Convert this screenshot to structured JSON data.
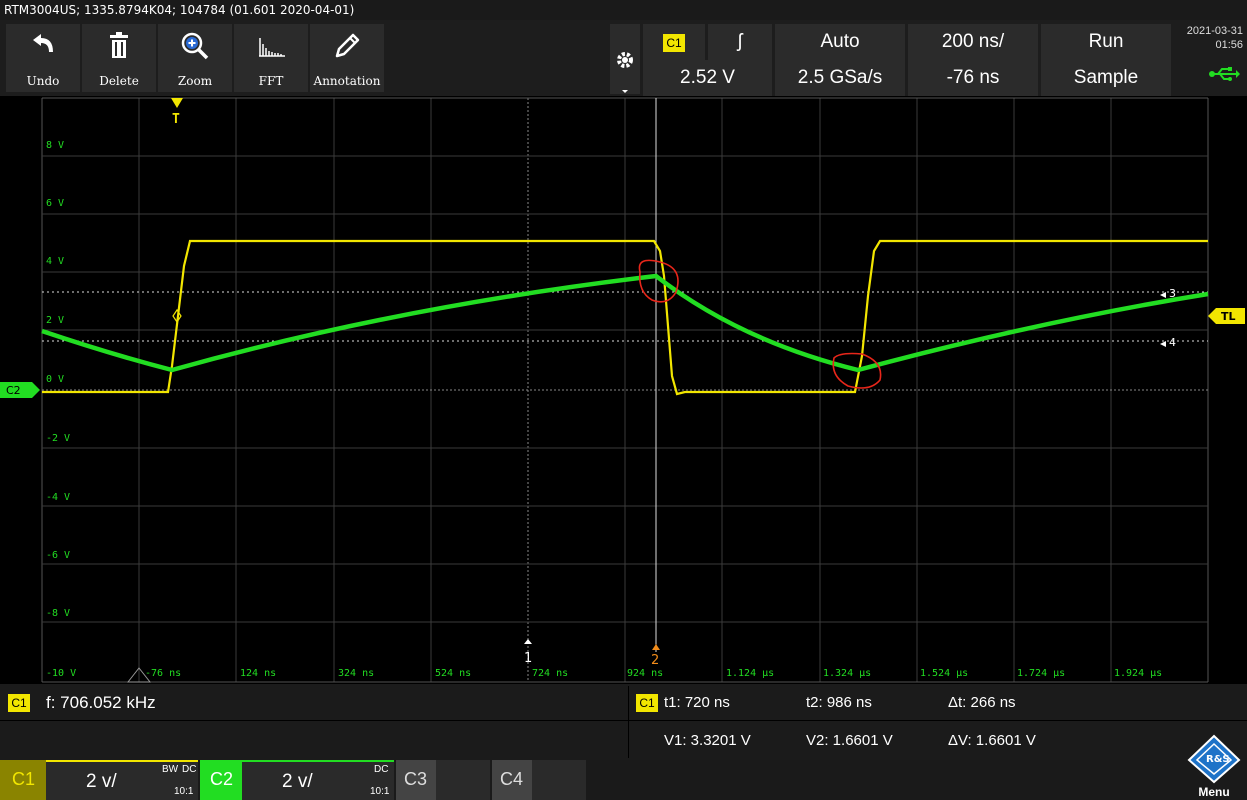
{
  "title": "RTM3004US; 1335.8794K04; 104784 (01.601 2020-04-01)",
  "toolbar": {
    "undo": "Undo",
    "delete": "Delete",
    "zoom": "Zoom",
    "fft": "FFT",
    "annotation": "Annotation"
  },
  "trigger": {
    "channel": "C1",
    "slope_symbol": "ʃ",
    "mode": "Auto",
    "timebase": "200 ns/",
    "run": "Run",
    "level": "2.52 V",
    "sample_rate": "2.5 GSa/s",
    "position": "-76 ns",
    "acquisition": "Sample"
  },
  "datetime": {
    "date": "2021-03-31",
    "time": "01:56"
  },
  "grid": {
    "y_labels": [
      "8 V",
      "6 V",
      "4 V",
      "2 V",
      "0 V",
      "-2 V",
      "-4 V",
      "-6 V",
      "-8 V",
      "-10 V"
    ],
    "x_labels": [
      "-76 ns",
      "124 ns",
      "324 ns",
      "524 ns",
      "724 ns",
      "924 ns",
      "1.124 µs",
      "1.324 µs",
      "1.524 µs",
      "1.724 µs",
      "1.924 µs"
    ],
    "marker_t": "T",
    "marker_c2": "C2",
    "marker_tl": "TL",
    "cursor_markers": [
      "1",
      "2",
      "3",
      "4"
    ]
  },
  "traces": {
    "c1_color": "#f2e600",
    "c2_color": "#22dd22",
    "annotation_color": "#e8261a"
  },
  "measurements": {
    "freq_channel": "C1",
    "frequency": "f: 706.052 kHz",
    "cursor_channel": "C1",
    "t1": "t1: 720 ns",
    "t2": "t2: 986 ns",
    "dt": "Δt: 266 ns",
    "v1": "V1: 3.3201 V",
    "v2": "V2: 1.6601 V",
    "dv": "ΔV: 1.6601 V"
  },
  "channels": {
    "c1": {
      "name": "C1",
      "scale": "2 v/",
      "coupling": "DC",
      "bw": "BW",
      "probe": "10:1"
    },
    "c2": {
      "name": "C2",
      "scale": "2 v/",
      "coupling": "DC",
      "probe": "10:1"
    },
    "c3": {
      "name": "C3"
    },
    "c4": {
      "name": "C4"
    },
    "menu": "Menu"
  }
}
